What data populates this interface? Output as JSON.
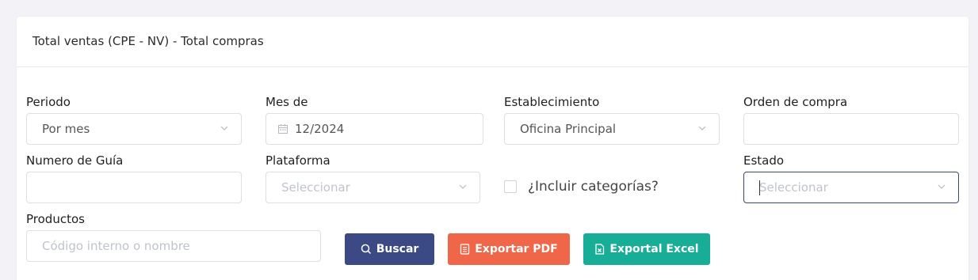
{
  "header": {
    "title": "Total ventas (CPE - NV) - Total compras"
  },
  "filters": {
    "periodo": {
      "label": "Periodo",
      "value": "Por mes"
    },
    "mes_de": {
      "label": "Mes de",
      "value": "12/2024"
    },
    "establecimiento": {
      "label": "Establecimiento",
      "value": "Oficina Principal"
    },
    "orden_compra": {
      "label": "Orden de compra",
      "value": ""
    },
    "numero_guia": {
      "label": "Numero de Guía",
      "value": ""
    },
    "plataforma": {
      "label": "Plataforma",
      "placeholder": "Seleccionar"
    },
    "incluir_categorias": {
      "label": "¿Incluir categorías?",
      "checked": false
    },
    "estado": {
      "label": "Estado",
      "placeholder": "Seleccionar"
    },
    "productos": {
      "label": "Productos",
      "placeholder": "Código interno o nombre"
    }
  },
  "buttons": {
    "buscar": {
      "label": "Buscar",
      "color": "#3b4a85",
      "icon": "search-icon"
    },
    "exportar_pdf": {
      "label": "Exportar PDF",
      "color": "#ef6649",
      "icon": "document-icon"
    },
    "exportar_excel": {
      "label": "Exportal Excel",
      "color": "#17ad96",
      "icon": "excel-file-icon"
    }
  }
}
